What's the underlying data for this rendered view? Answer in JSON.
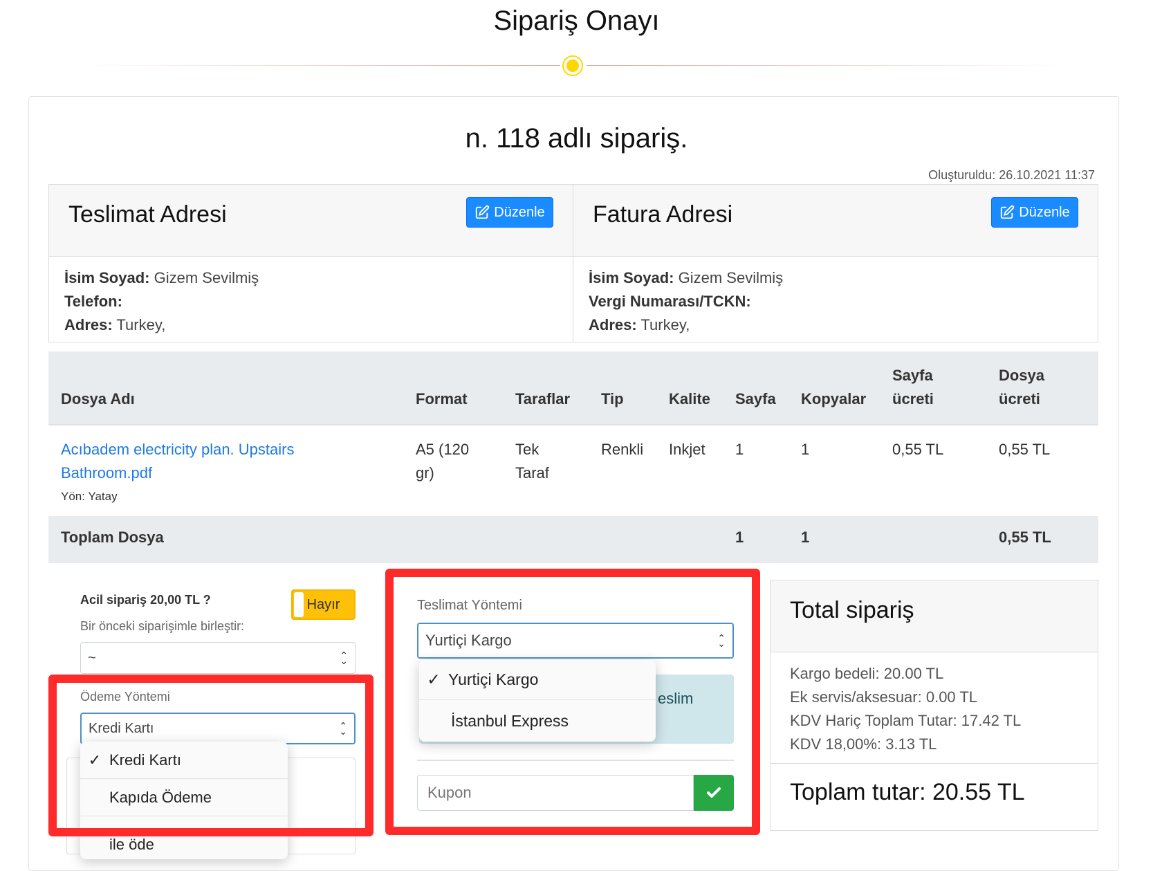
{
  "page_title": "Sipariş Onayı",
  "order_title": "n. 118 adlı sipariş.",
  "created_at": "Oluşturuldu: 26.10.2021 11:37",
  "edit_label": "Düzenle",
  "delivery_address": {
    "title": "Teslimat Adresi",
    "name_label": "İsim Soyad:",
    "name_value": "Gizem Sevilmiş",
    "phone_label": "Telefon:",
    "address_label": "Adres:",
    "address_value": "Turkey,"
  },
  "billing_address": {
    "title": "Fatura Adresi",
    "name_label": "İsim Soyad:",
    "name_value": "Gizem Sevilmiş",
    "tax_label": "Vergi Numarası/TCKN:",
    "address_label": "Adres:",
    "address_value": "Turkey,"
  },
  "table": {
    "headers": {
      "file_name": "Dosya Adı",
      "format": "Format",
      "sides": "Taraflar",
      "type": "Tip",
      "quality": "Kalite",
      "pages": "Sayfa",
      "copies": "Kopyalar",
      "page_fee_1": "Sayfa",
      "page_fee_2": "ücreti",
      "file_fee_1": "Dosya",
      "file_fee_2": "ücreti"
    },
    "row": {
      "file_name_1": "Acıbadem electricity plan. Upstairs",
      "file_name_2": "Bathroom.pdf",
      "orientation": "Yön: Yatay",
      "format_1": "A5 (120",
      "format_2": "gr)",
      "sides_1": "Tek",
      "sides_2": "Taraf",
      "type": "Renkli",
      "quality": "Inkjet",
      "pages": "1",
      "copies": "1",
      "page_fee": "0,55 TL",
      "file_fee": "0,55 TL"
    },
    "total": {
      "label": "Toplam Dosya",
      "pages": "1",
      "copies": "1",
      "fee": "0,55 TL"
    }
  },
  "options": {
    "urgent_label": "Acil sipariş 20,00 TL ?",
    "urgent_toggle": "Hayır",
    "merge_label": "Bir önceki siparişimle birleştir:",
    "merge_value": "~",
    "payment_label": "Ödeme Yöntemi",
    "payment_value": "Kredi Kartı",
    "payment_options": [
      "Kredi Kartı",
      "Kapıda Ödeme"
    ],
    "payment_partial": "ile öde"
  },
  "delivery": {
    "label": "Teslimat Yöntemi",
    "value": "Yurtiçi Kargo",
    "options": [
      "Yurtiçi Kargo",
      "İstanbul Express"
    ],
    "behind_text": "eslim",
    "coupon_placeholder": "Kupon"
  },
  "summary": {
    "title": "Total sipariş",
    "shipping": "Kargo bedeli: 20.00 TL",
    "extra": "Ek servis/aksesuar: 0.00 TL",
    "excl_vat": "KDV Hariç Toplam Tutar: 17.42 TL",
    "vat": "KDV 18,00%: 3.13 TL",
    "total": "Toplam tutar: 20.55 TL"
  },
  "colors": {
    "primary": "#1a8cff",
    "highlight_red": "#ff2a2a",
    "toggle_yellow": "#ffc107",
    "success_green": "#28a745",
    "table_header_bg": "#e9ecef",
    "info_bg": "#cfe6ea"
  }
}
